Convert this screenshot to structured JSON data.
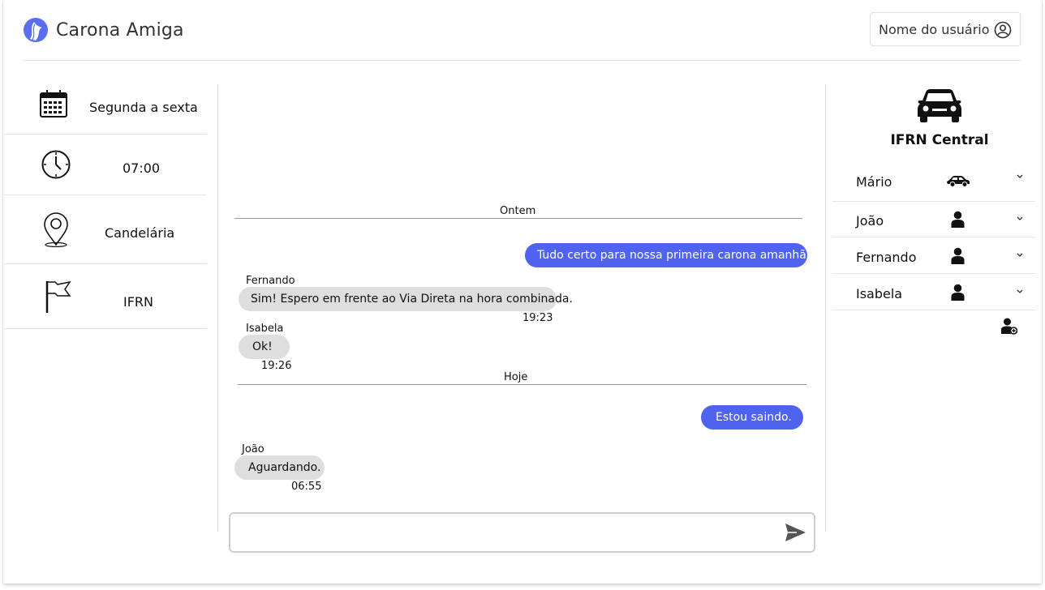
{
  "app": {
    "title": "Carona Amiga"
  },
  "header": {
    "user_label": "Nome do usuário",
    "user_icon": "user-circle-icon"
  },
  "ride_info": {
    "days": "Segunda a sexta",
    "time": "07:00",
    "origin": "Candelária",
    "destination": "IFRN"
  },
  "chat": {
    "dividers": [
      "Ontem",
      "Hoje"
    ],
    "messages": [
      {
        "direction": "out",
        "text": "Tudo certo para nossa primeira carona amanhã?"
      },
      {
        "direction": "in",
        "sender": "Fernando",
        "text": "Sim! Espero em frente ao Via Direta na hora combinada.",
        "time": "19:23"
      },
      {
        "direction": "in",
        "sender": "Isabela",
        "text": "Ok!",
        "time": "19:26"
      },
      {
        "direction": "out",
        "text": "Estou saindo."
      },
      {
        "direction": "in",
        "sender": "João",
        "text": "Aguardando.",
        "time": "06:55"
      }
    ],
    "input": {
      "value": "",
      "placeholder": ""
    }
  },
  "group": {
    "title": "IFRN Central",
    "members": [
      {
        "name": "Mário",
        "role_icon": "car-icon"
      },
      {
        "name": "João",
        "role_icon": "person-icon"
      },
      {
        "name": "Fernando",
        "role_icon": "person-icon"
      },
      {
        "name": "Isabela",
        "role_icon": "person-icon"
      }
    ]
  },
  "colors": {
    "accent": "#4f63f0",
    "bubble_in": "#dedede"
  }
}
